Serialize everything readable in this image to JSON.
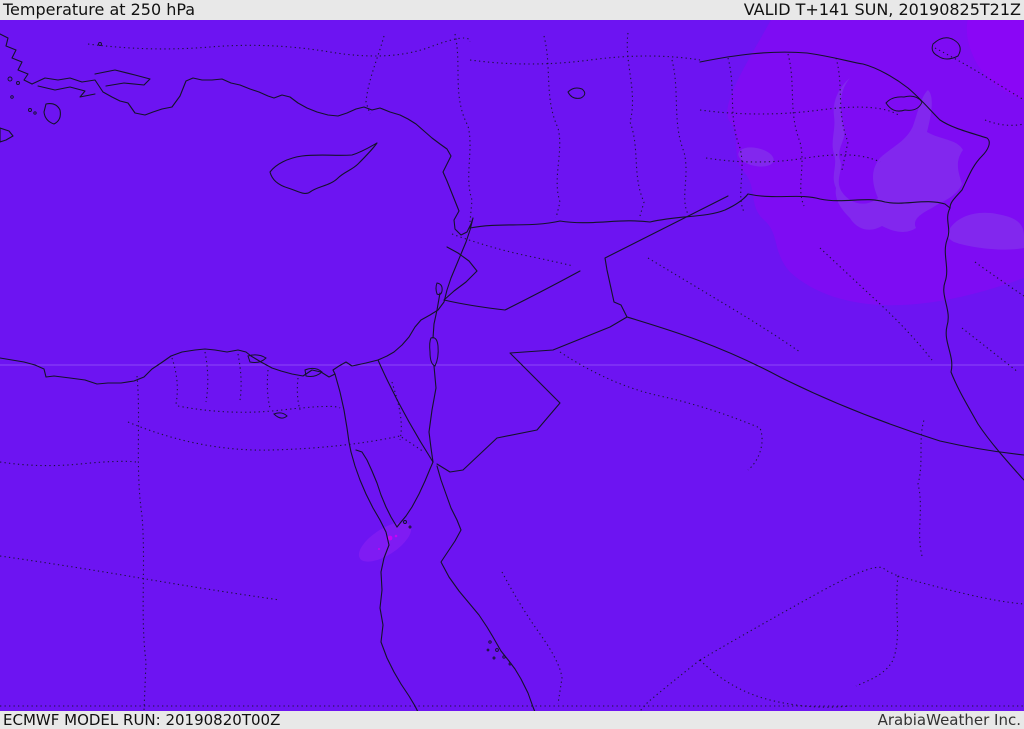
{
  "header": {
    "title": "Temperature at 250 hPa",
    "valid_time": "VALID T+141 SUN, 20190825T21Z"
  },
  "footer": {
    "model_run": "ECMWF MODEL RUN: 20190820T00Z",
    "provider": "ArabiaWeather Inc."
  },
  "map": {
    "type": "temperature-contour-field",
    "region": "Middle East / Eastern Mediterranean",
    "features": [
      "coastlines",
      "country-borders",
      "admin-dotted-borders",
      "lakes",
      "islands"
    ]
  },
  "colors": {
    "base": "#6D14F2",
    "warm_band": "#7E0CF3",
    "warm_corner": "#8C05F6",
    "cool_blob": "#8227EE",
    "suez_patch": "#7F1BF3",
    "hot_spot": "#C603F8",
    "line": "#14122a",
    "bar_bg": "#e8e8e8",
    "bar_text": "#111111",
    "provider_text": "#333333",
    "graticule": "rgba(255,255,255,0.22)"
  }
}
